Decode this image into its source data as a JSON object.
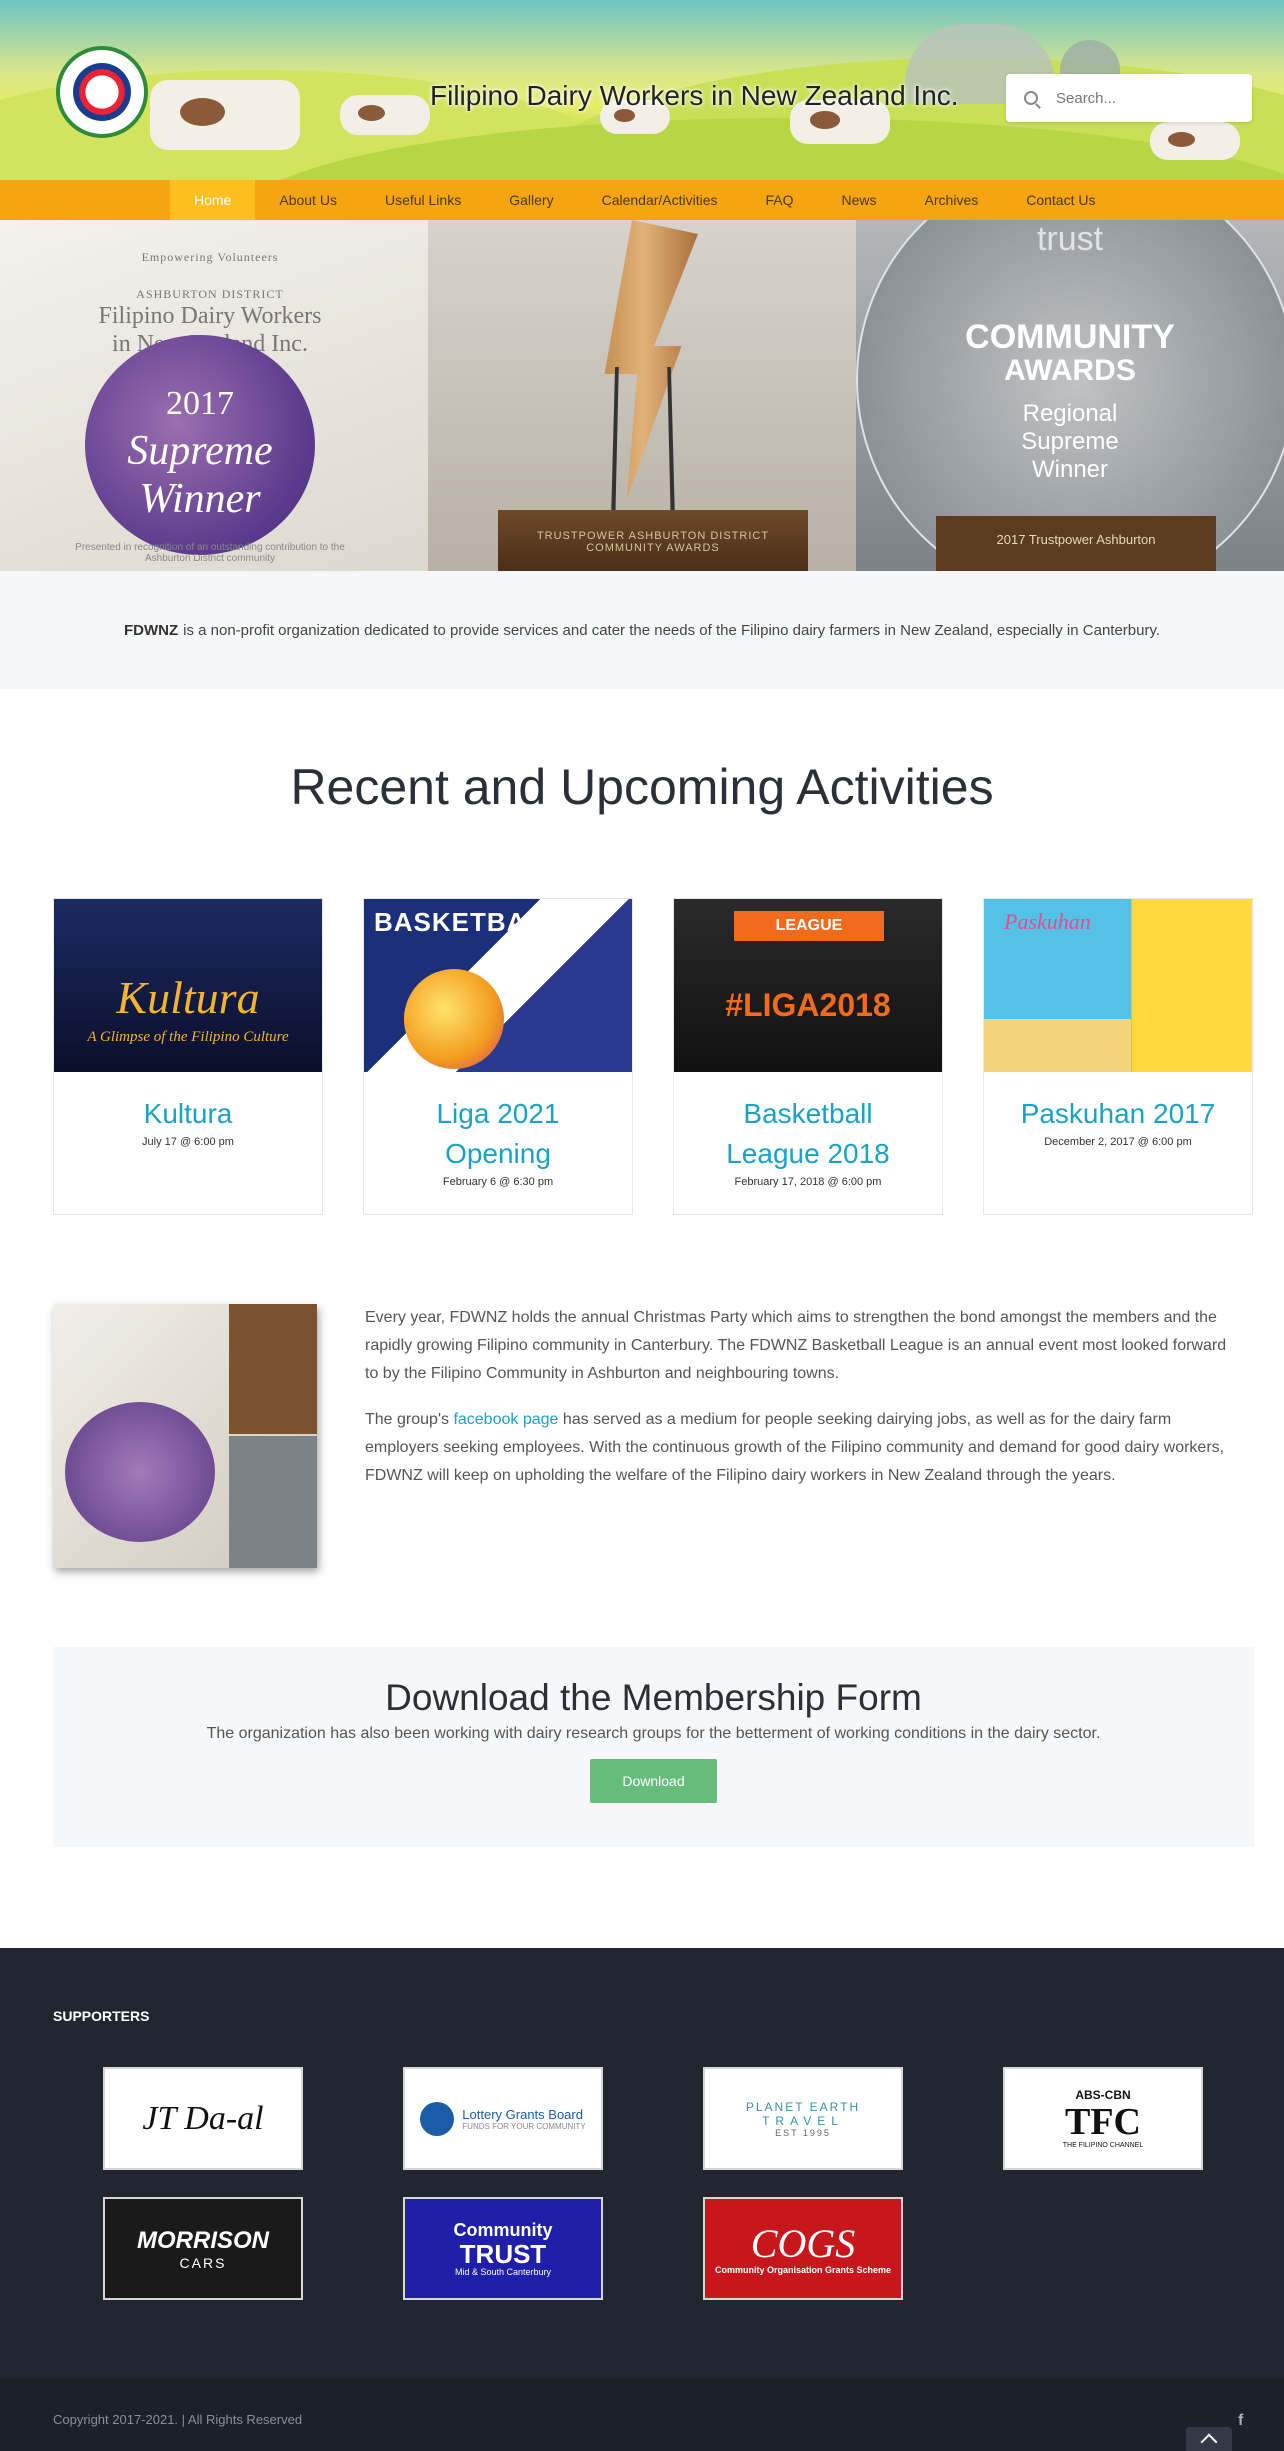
{
  "site": {
    "title": "Filipino Dairy Workers in New Zealand Inc.",
    "search_placeholder": "Search..."
  },
  "nav": {
    "items": [
      {
        "label": "Home",
        "active": true
      },
      {
        "label": "About Us"
      },
      {
        "label": "Useful Links"
      },
      {
        "label": "Gallery"
      },
      {
        "label": "Calendar/Activities"
      },
      {
        "label": "FAQ"
      },
      {
        "label": "News"
      },
      {
        "label": "Archives"
      },
      {
        "label": "Contact Us"
      }
    ]
  },
  "hero": {
    "certificate": {
      "top": "Empowering Volunteers",
      "district": "ASHBURTON DISTRICT",
      "org_line1": "Filipino Dairy Workers",
      "org_line2": "in New Zealand Inc.",
      "year": "2017",
      "award_line1": "Supreme",
      "award_line2": "Winner",
      "footer": "Presented in recognition of an outstanding contribution to the Ashburton District community"
    },
    "trophy_plate": "TRUSTPOWER ASHBURTON DISTRICT COMMUNITY AWARDS",
    "award": {
      "brand": "trust",
      "line1": "COMMUNITY",
      "line2": "AWARDS",
      "line3": "Regional",
      "line4": "Supreme",
      "line5": "Winner",
      "plate": "2017 Trustpower Ashburton"
    }
  },
  "about": {
    "bold": "FDWNZ",
    "text": "is a non-profit organization dedicated to provide services and cater the needs of the Filipino dairy farmers in New Zealand, especially in Canterbury."
  },
  "activities": {
    "title": "Recent and Upcoming Activities",
    "items": [
      {
        "title": "Kultura",
        "date": "July 17 @ 6:00 pm",
        "thumb_text": "Kultura",
        "thumb_sub": "A Glimpse of the Filipino Culture"
      },
      {
        "title": "Liga 2021 Opening",
        "date": "February 6 @ 6:30 pm",
        "thumb_text": "BASKETBALL"
      },
      {
        "title": "Basketball League 2018",
        "date": "February 17, 2018 @ 6:00 pm",
        "thumb_text": "#LIGA2018",
        "thumb_banner": "LEAGUE"
      },
      {
        "title": "Paskuhan 2017",
        "date": "December 2, 2017 @ 6:00 pm",
        "thumb_text": "Paskuhan"
      }
    ]
  },
  "story": {
    "p1": "Every year, FDWNZ holds the annual Christmas Party which aims to strengthen the bond amongst the members and the rapidly growing Filipino community in Canterbury. The FDWNZ Basketball League is an annual event most looked forward to by the Filipino Community in Ashburton and neighbouring towns.",
    "p2_pre": "The group's ",
    "p2_link": "facebook page",
    "p2_post": " has served as a medium for people seeking dairying jobs, as well as for the dairy farm employers seeking employees. With the continuous growth of the Filipino community and demand for good dairy workers, FDWNZ will keep on upholding the welfare of the Filipino dairy workers in New Zealand through the years."
  },
  "membership": {
    "title": "Download the Membership Form",
    "text": "The organization has also been working with dairy research groups for the betterment of working conditions in the dairy sector.",
    "button": "Download"
  },
  "footer": {
    "heading": "SUPPORTERS",
    "supporters": [
      {
        "name": "JT Da-al"
      },
      {
        "name": "Lottery Grants Board",
        "sub": "FUNDS FOR YOUR COMMUNITY"
      },
      {
        "name": "PLANET EARTH",
        "sub": "TRAVEL",
        "sub2": "EST 1995"
      },
      {
        "name": "ABS-CBN",
        "big": "TFC",
        "sub": "THE FILIPINO CHANNEL"
      },
      {
        "name": "MORRISON",
        "sub": "CARS"
      },
      {
        "name": "Community",
        "big": "TRUST",
        "sub": "Mid & South Canterbury"
      },
      {
        "name": "COGS",
        "sub": "Community Organisation Grants Scheme"
      }
    ],
    "copyright": "Copyright 2017-2021. | All Rights Reserved",
    "facebook": "f"
  },
  "colors": {
    "nav_bg": "#f5a511",
    "nav_active": "#fcbf1e",
    "link": "#1aa1c8",
    "button": "#65bc7b",
    "footer_bg": "#212631"
  }
}
